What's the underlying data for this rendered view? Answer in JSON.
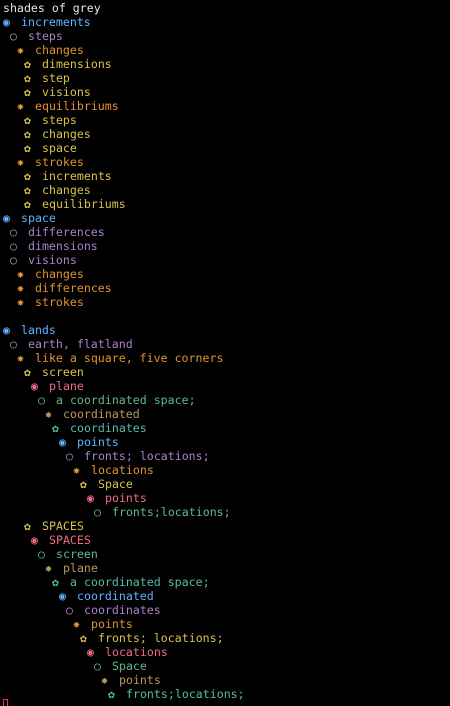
{
  "title": "shades of grey",
  "colors": {
    "blue": "#5fb3ff",
    "purple": "#a783c8",
    "orange": "#e0922f",
    "yellow": "#d8c24a",
    "red": "#f06a82",
    "green": "#5fb98a",
    "olive": "#b79a5a",
    "teal": "#52bfa8",
    "ink": "#e6e6e6"
  },
  "lines": [
    {
      "depth": 0,
      "bullet": "◉",
      "color": "blue",
      "text": "increments"
    },
    {
      "depth": 1,
      "bullet": "○",
      "color": "purple",
      "text": "steps"
    },
    {
      "depth": 2,
      "bullet": "✸",
      "color": "orange",
      "text": "changes"
    },
    {
      "depth": 3,
      "bullet": "✿",
      "color": "yellow",
      "text": "dimensions"
    },
    {
      "depth": 3,
      "bullet": "✿",
      "color": "yellow",
      "text": "step"
    },
    {
      "depth": 3,
      "bullet": "✿",
      "color": "yellow",
      "text": "visions"
    },
    {
      "depth": 2,
      "bullet": "✸",
      "color": "orange",
      "text": "equilibriums"
    },
    {
      "depth": 3,
      "bullet": "✿",
      "color": "yellow",
      "text": "steps"
    },
    {
      "depth": 3,
      "bullet": "✿",
      "color": "yellow",
      "text": "changes"
    },
    {
      "depth": 3,
      "bullet": "✿",
      "color": "yellow",
      "text": "space"
    },
    {
      "depth": 2,
      "bullet": "✸",
      "color": "orange",
      "text": "strokes"
    },
    {
      "depth": 3,
      "bullet": "✿",
      "color": "yellow",
      "text": "increments"
    },
    {
      "depth": 3,
      "bullet": "✿",
      "color": "yellow",
      "text": "changes"
    },
    {
      "depth": 3,
      "bullet": "✿",
      "color": "yellow",
      "text": "equilibriums"
    },
    {
      "depth": 0,
      "bullet": "◉",
      "color": "blue",
      "text": "space"
    },
    {
      "depth": 1,
      "bullet": "○",
      "color": "purple",
      "text": "differences"
    },
    {
      "depth": 1,
      "bullet": "○",
      "color": "purple",
      "text": "dimensions"
    },
    {
      "depth": 1,
      "bullet": "○",
      "color": "purple",
      "text": "visions"
    },
    {
      "depth": 2,
      "bullet": "✸",
      "color": "orange",
      "text": "changes"
    },
    {
      "depth": 2,
      "bullet": "✸",
      "color": "orange",
      "text": "differences"
    },
    {
      "depth": 2,
      "bullet": "✸",
      "color": "orange",
      "text": "strokes"
    },
    {
      "depth": 0,
      "bullet": "",
      "color": "ink",
      "text": ""
    },
    {
      "depth": 0,
      "bullet": "◉",
      "color": "blue",
      "text": "lands"
    },
    {
      "depth": 1,
      "bullet": "○",
      "color": "purple",
      "text": "earth, flatland"
    },
    {
      "depth": 2,
      "bullet": "✸",
      "color": "orange",
      "text": "like a square, five corners"
    },
    {
      "depth": 3,
      "bullet": "✿",
      "color": "yellow",
      "text": "screen"
    },
    {
      "depth": 4,
      "bullet": "◉",
      "color": "red",
      "text": "plane"
    },
    {
      "depth": 5,
      "bullet": "○",
      "color": "green",
      "text": "a coordinated space;"
    },
    {
      "depth": 6,
      "bullet": "✸",
      "color": "olive",
      "text": "coordinated"
    },
    {
      "depth": 7,
      "bullet": "✿",
      "color": "teal",
      "text": "coordinates"
    },
    {
      "depth": 8,
      "bullet": "◉",
      "color": "blue",
      "text": "points"
    },
    {
      "depth": 9,
      "bullet": "○",
      "color": "purple",
      "text": "fronts; locations;"
    },
    {
      "depth": 10,
      "bullet": "✸",
      "color": "orange",
      "text": "locations"
    },
    {
      "depth": 11,
      "bullet": "✿",
      "color": "yellow",
      "text": "Space"
    },
    {
      "depth": 12,
      "bullet": "◉",
      "color": "red",
      "text": "points"
    },
    {
      "depth": 13,
      "bullet": "○",
      "color": "green",
      "text": "fronts;locations;"
    },
    {
      "depth": 3,
      "bullet": "✿",
      "color": "yellow",
      "text": "SPACES"
    },
    {
      "depth": 4,
      "bullet": "◉",
      "color": "red",
      "text": "SPACES"
    },
    {
      "depth": 5,
      "bullet": "○",
      "color": "green",
      "text": "screen"
    },
    {
      "depth": 6,
      "bullet": "✸",
      "color": "olive",
      "text": "plane"
    },
    {
      "depth": 7,
      "bullet": "✿",
      "color": "teal",
      "text": "a coordinated space;"
    },
    {
      "depth": 8,
      "bullet": "◉",
      "color": "blue",
      "text": "coordinated"
    },
    {
      "depth": 9,
      "bullet": "○",
      "color": "purple",
      "text": "coordinates"
    },
    {
      "depth": 10,
      "bullet": "✸",
      "color": "orange",
      "text": "points"
    },
    {
      "depth": 11,
      "bullet": "✿",
      "color": "yellow",
      "text": "fronts; locations;"
    },
    {
      "depth": 12,
      "bullet": "◉",
      "color": "red",
      "text": "locations"
    },
    {
      "depth": 13,
      "bullet": "○",
      "color": "green",
      "text": "Space"
    },
    {
      "depth": 14,
      "bullet": "✸",
      "color": "olive",
      "text": "points"
    },
    {
      "depth": 15,
      "bullet": "✿",
      "color": "teal",
      "text": "fronts;locations;"
    }
  ]
}
